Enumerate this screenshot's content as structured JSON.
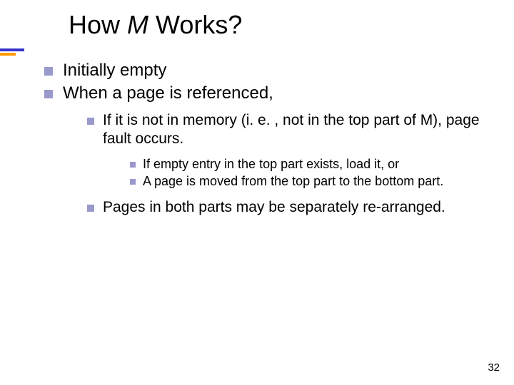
{
  "title": {
    "pre": "How ",
    "italic": "M",
    "post": "  Works?"
  },
  "bullets": {
    "b1": "Initially empty",
    "b2": "When a page is referenced,",
    "b2_1": "If it is not in memory (i. e. , not in the top part of M), page fault occurs.",
    "b2_1_1": "If empty entry in the top part exists, load it,  or",
    "b2_1_2": "A page is moved from the top part to the bottom part.",
    "b2_2": "Pages in both parts may be separately re-arranged."
  },
  "page_number": "32"
}
